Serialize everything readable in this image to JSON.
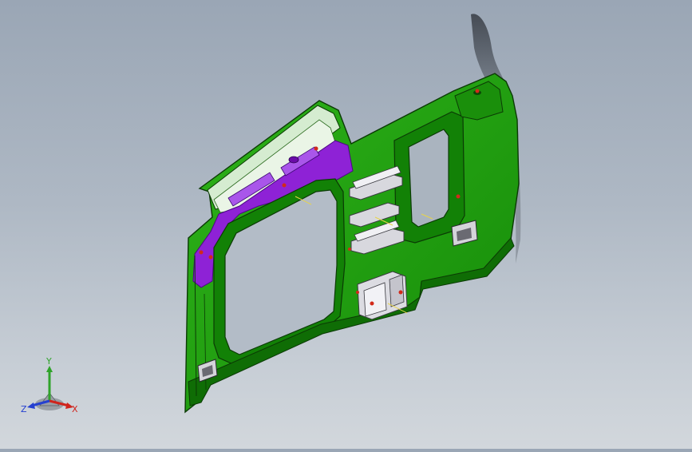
{
  "viewport": {
    "part_name": "",
    "colors": {
      "body": "#1f9a0c",
      "body_dark": "#0f6d05",
      "edge": "#0b3a05",
      "highlight": "#c8e7c0",
      "purple": "#8c1fd4",
      "purple_dark": "#5a0f9a",
      "bracket": "#d6d6dc",
      "marker": "#d22a1a"
    }
  },
  "triad": {
    "x_label": "X",
    "y_label": "Y",
    "z_label": "Z",
    "colors": {
      "x": "#d0241c",
      "y": "#2fa32a",
      "z": "#2540d0"
    }
  }
}
